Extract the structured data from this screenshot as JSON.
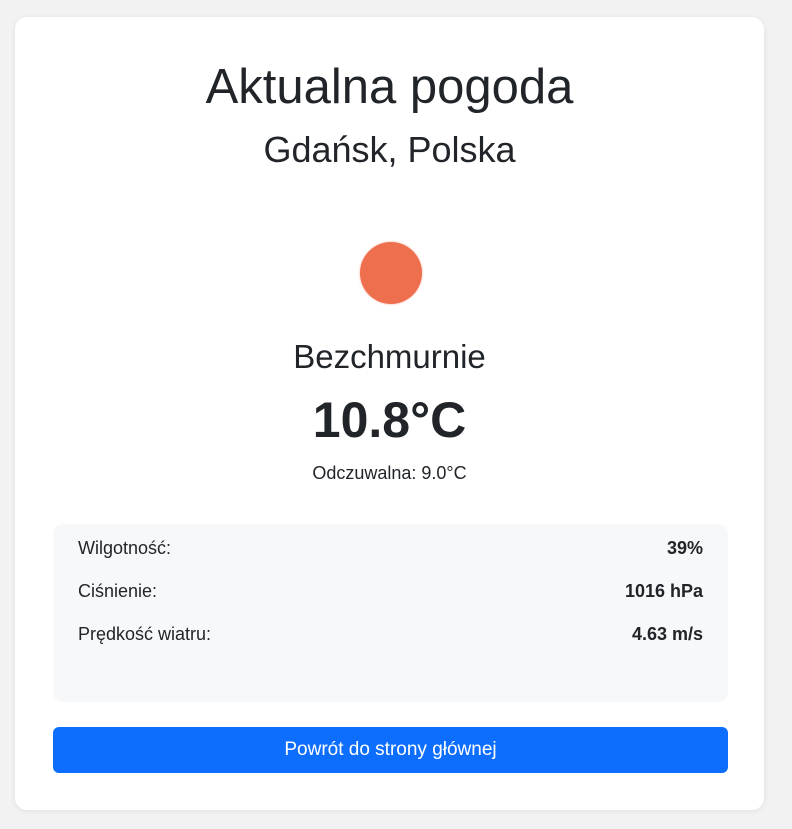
{
  "header": {
    "title": "Aktualna pogoda",
    "location": "Gdańsk, Polska"
  },
  "weather": {
    "icon": "sun-icon",
    "icon_color": "#ee6f4e",
    "description": "Bezchmurnie",
    "temperature": "10.8°C",
    "feels_like": "Odczuwalna: 9.0°C"
  },
  "details": [
    {
      "label": "Wilgotność:",
      "value": "39%"
    },
    {
      "label": "Ciśnienie:",
      "value": "1016 hPa"
    },
    {
      "label": "Prędkość wiatru:",
      "value": "4.63 m/s"
    }
  ],
  "actions": {
    "back_label": "Powrót do strony głównej",
    "accent_color": "#0d6efd"
  }
}
